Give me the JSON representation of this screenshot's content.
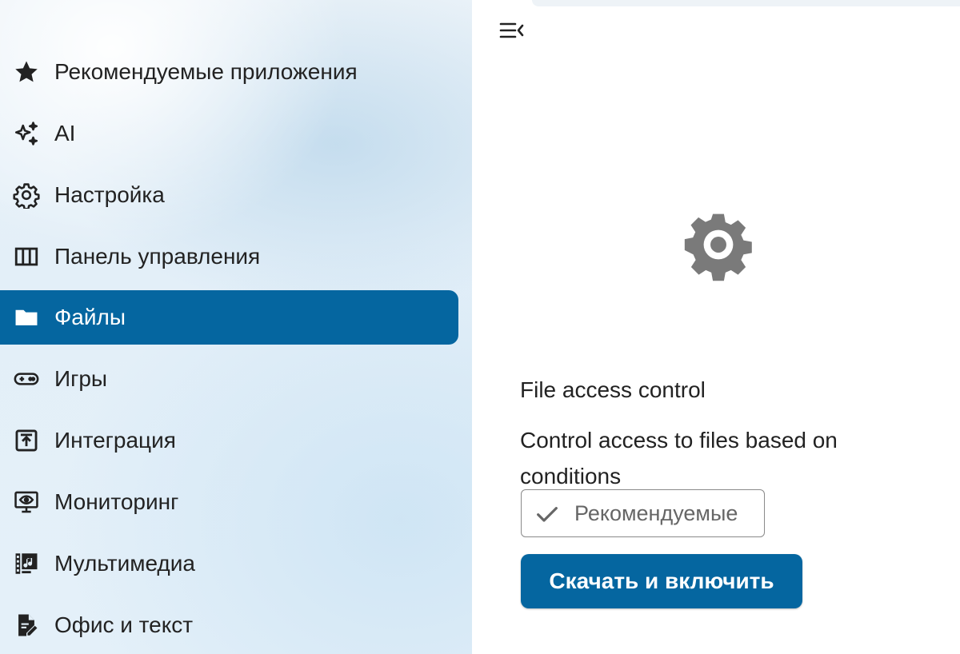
{
  "sidebar": {
    "items": [
      {
        "label": "Рекомендуемые приложения",
        "icon": "star-icon",
        "active": false
      },
      {
        "label": "AI",
        "icon": "sparkles-icon",
        "active": false
      },
      {
        "label": "Настройка",
        "icon": "gear-icon",
        "active": false
      },
      {
        "label": "Панель управления",
        "icon": "dashboard-columns-icon",
        "active": false
      },
      {
        "label": "Файлы",
        "icon": "folder-icon",
        "active": true
      },
      {
        "label": "Игры",
        "icon": "gamepad-icon",
        "active": false
      },
      {
        "label": "Интеграция",
        "icon": "upload-box-icon",
        "active": false
      },
      {
        "label": "Мониторинг",
        "icon": "monitor-eye-icon",
        "active": false
      },
      {
        "label": "Мультимедиа",
        "icon": "multimedia-icon",
        "active": false
      },
      {
        "label": "Офис и текст",
        "icon": "document-edit-icon",
        "active": false
      }
    ]
  },
  "header": {
    "menu_toggle_icon": "menu-collapse-icon"
  },
  "app": {
    "icon": "gear-icon",
    "title": "File access control",
    "description": "Control access to files based on conditions",
    "badge": {
      "icon": "check-icon",
      "label": "Рекомендуемые"
    },
    "action_label": "Скачать и включить"
  },
  "colors": {
    "accent": "#0566a0",
    "text": "#222222",
    "icon_gray": "#7a7a7a"
  }
}
